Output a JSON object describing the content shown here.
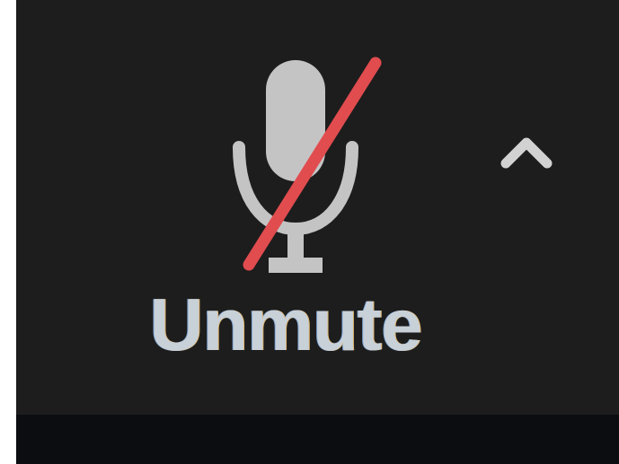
{
  "toolbar": {
    "audio_button": {
      "label": "Unmute",
      "icon": "muted-microphone-icon"
    },
    "audio_options": {
      "icon": "chevron-up-icon"
    }
  },
  "colors": {
    "panel_background": "#1d1d1d",
    "icon_gray": "#c4c4c4",
    "mute_slash_red": "#e14c4f",
    "label_text": "#c8d0d8"
  }
}
